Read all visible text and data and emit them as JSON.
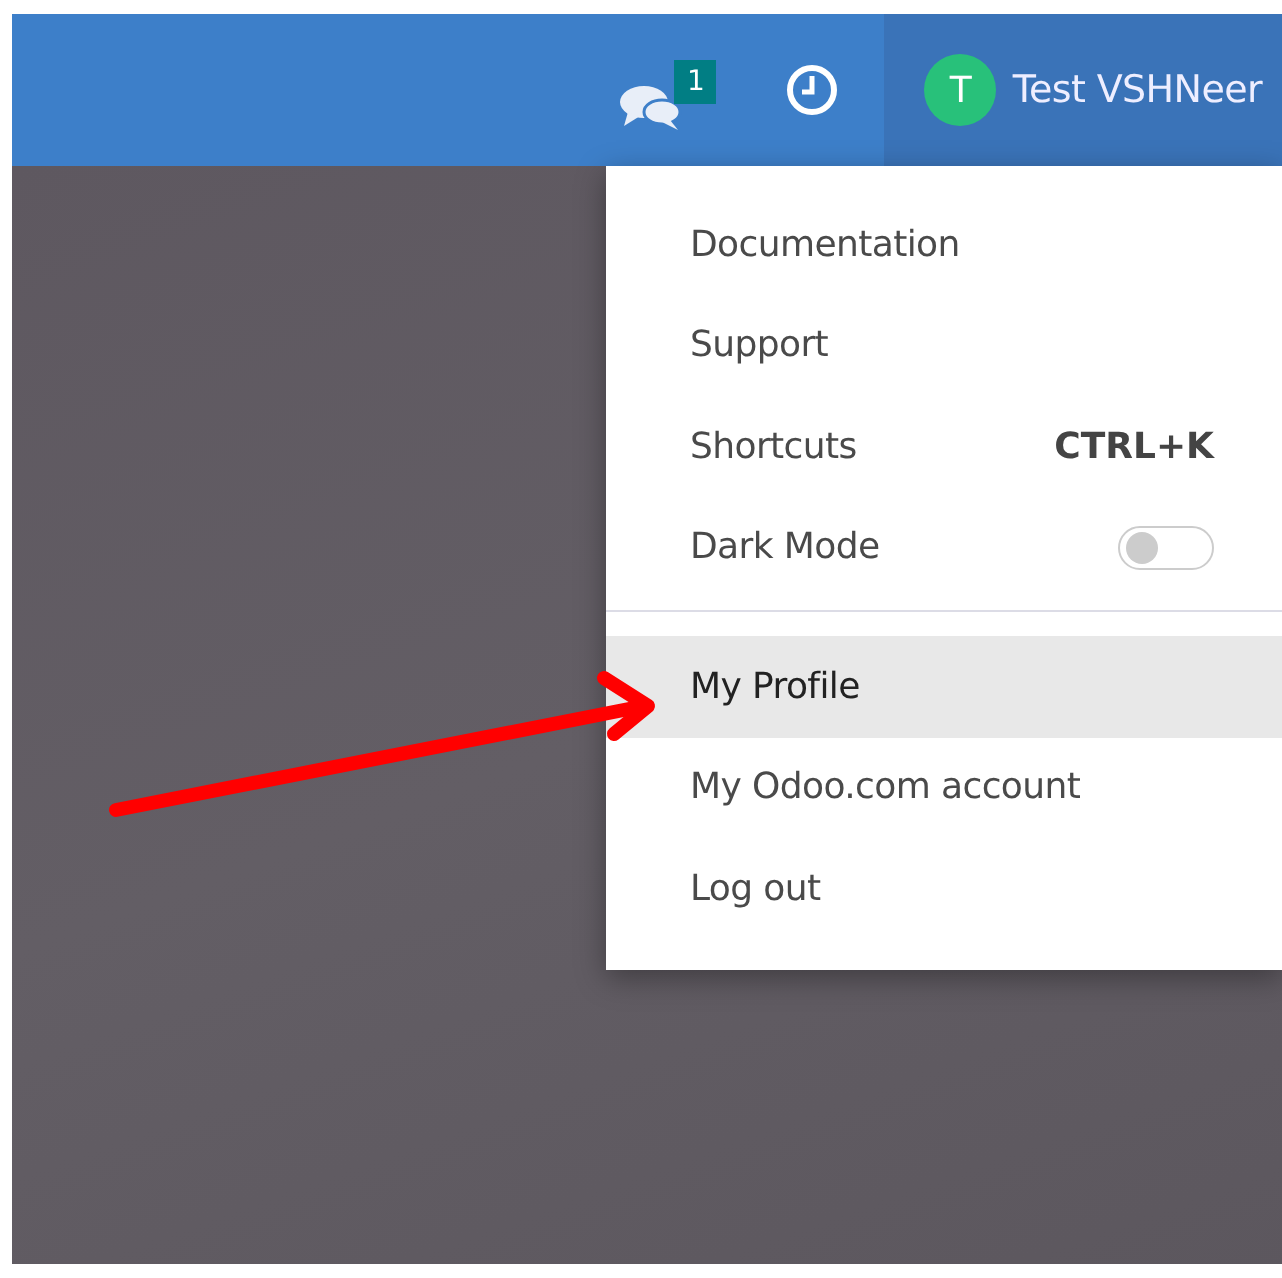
{
  "navbar": {
    "messages_badge": "1",
    "user": {
      "initial": "T",
      "name": "Test VSHNeer"
    }
  },
  "user_menu": {
    "items": [
      {
        "kind": "link",
        "label": "Documentation",
        "selected": false
      },
      {
        "kind": "link",
        "label": "Support",
        "selected": false
      },
      {
        "kind": "shortcut",
        "label": "Shortcuts",
        "shortcut": "CTRL+K",
        "selected": false
      },
      {
        "kind": "toggle",
        "label": "Dark Mode",
        "on": false,
        "selected": false
      },
      {
        "kind": "divider"
      },
      {
        "kind": "link",
        "label": "My Profile",
        "selected": true
      },
      {
        "kind": "link",
        "label": "My Odoo.com account",
        "selected": false
      },
      {
        "kind": "link",
        "label": "Log out",
        "selected": false
      }
    ]
  }
}
